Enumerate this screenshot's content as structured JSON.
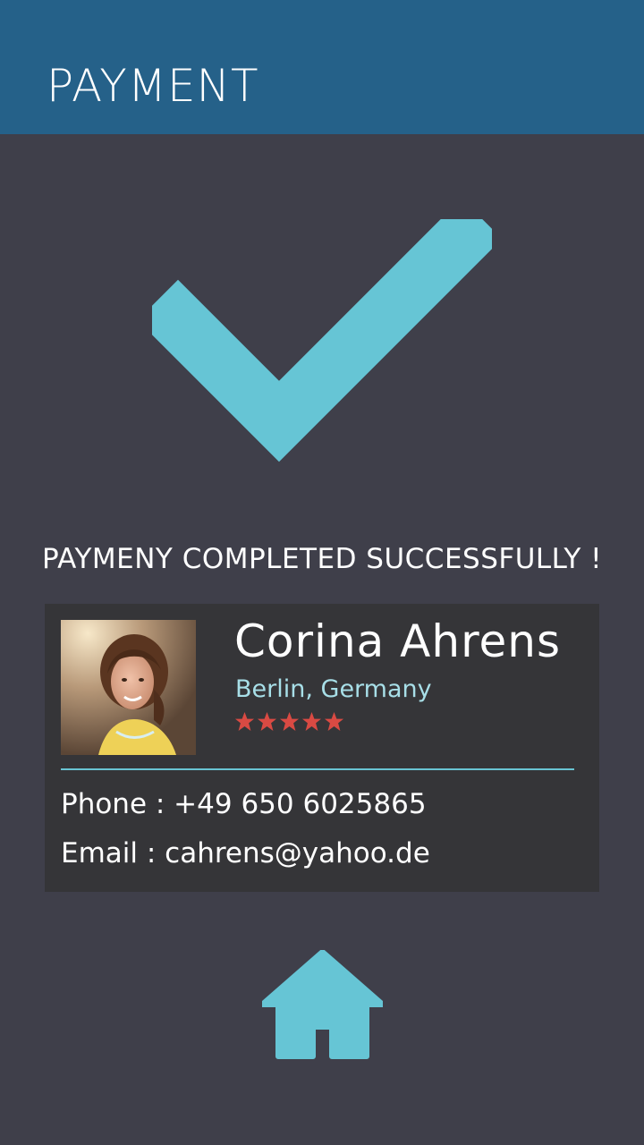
{
  "header": {
    "title": "PAYMENT"
  },
  "status": {
    "icon": "checkmark-icon",
    "message": "PAYMENY COMPLETED SUCCESSFULLY !"
  },
  "profile": {
    "name": "Corina Ahrens",
    "location": "Berlin, Germany",
    "rating": 5,
    "rating_max": 5,
    "phone_label": "Phone",
    "phone": "+49 650 6025865",
    "email_label": "Email",
    "email": "cahrens@yahoo.de",
    "phone_line": "Phone : +49 650 6025865",
    "email_line": "Email : cahrens@yahoo.de"
  },
  "navigation": {
    "home_icon": "home-icon"
  },
  "colors": {
    "header_bg": "#256189",
    "page_bg": "#3f3f4a",
    "card_bg": "#353538",
    "accent": "#69c4d3",
    "star": "#d94a43"
  }
}
